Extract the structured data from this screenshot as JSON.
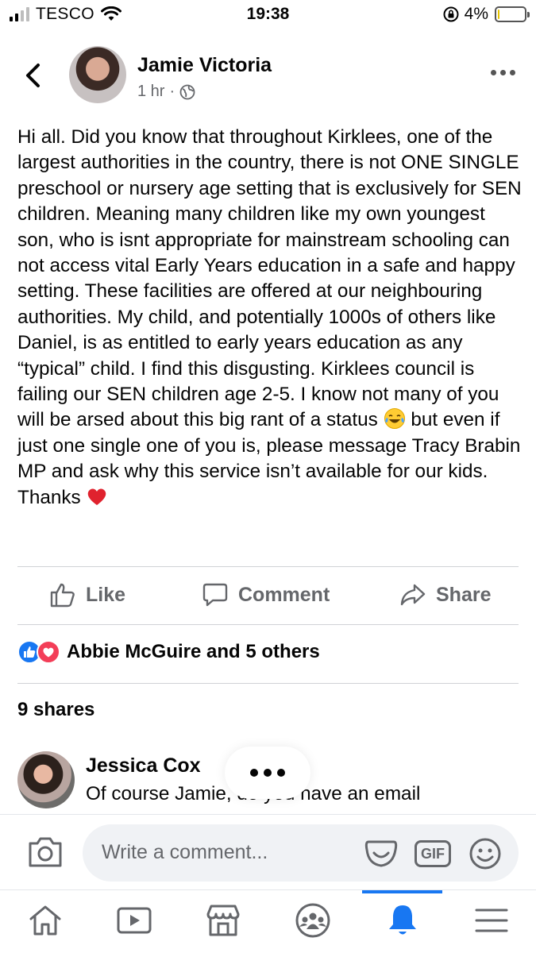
{
  "status_bar": {
    "carrier": "TESCO",
    "time": "19:38",
    "battery_text": "4%",
    "battery_level": 0.04
  },
  "post": {
    "author": "Jamie Victoria",
    "time": "1 hr",
    "dot": "·",
    "privacy_icon": "globe-icon",
    "body_part1": "Hi all. Did you know that throughout Kirklees, one of the largest authorities in the country, there is not ONE SINGLE preschool or nursery age setting that is exclusively for SEN children. Meaning many children like my own youngest son, who is isnt appropriate for mainstream schooling can not access vital Early Years education in a safe and happy setting. These facilities are offered at our neighbouring authorities. My child, and potentially 1000s of others like Daniel, is as entitled to early years education as any “typical” child. I find this disgusting. Kirklees council is failing our SEN children age 2-5. I know not many of you will be arsed about this big rant of a status",
    "body_part2": " but even if just one single one of you is, please message Tracy Brabin MP and ask why this service isn’t available for our kids. Thanks",
    "emoji_1": "laughing-tears-emoji",
    "emoji_2": "red-heart-emoji"
  },
  "actions": {
    "like": "Like",
    "comment": "Comment",
    "share": "Share"
  },
  "reactions": {
    "summary": "Abbie McGuire and 5 others",
    "icons": [
      "like-reaction-icon",
      "love-reaction-icon"
    ]
  },
  "shares": "9 shares",
  "comment_preview": {
    "author": "Jessica Cox",
    "text": "Of course Jamie, do you have an email"
  },
  "composer": {
    "placeholder": "Write a comment...",
    "gif_label": "GIF"
  },
  "tabs": [
    "home-icon",
    "watch-icon",
    "marketplace-icon",
    "groups-icon",
    "notifications-icon",
    "menu-icon"
  ],
  "colors": {
    "accent": "#1877f2",
    "love": "#f33e58",
    "secondary_text": "#65676b"
  }
}
